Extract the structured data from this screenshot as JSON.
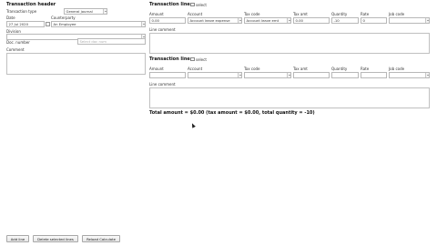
{
  "header": {
    "title": "Transaction header",
    "transaction_type_label": "Transaction type",
    "transaction_type_value": "General journal",
    "date_label": "Date",
    "date_value": "27 Jul 2020",
    "counterparty_label": "Counterparty",
    "counterparty_value": "An Employee",
    "division_label": "Division",
    "doc_number_label": "Doc. number",
    "doc_number_placeholder": "Select doc num",
    "comment_label": "Comment"
  },
  "lines": [
    {
      "title": "Transaction line",
      "select_label": "select",
      "columns": [
        "Amount",
        "Account",
        "Tax code",
        "Tax amt",
        "Quantity",
        "Rate",
        "Job code"
      ],
      "amount": "0.00",
      "account": "Account leave expense",
      "tax_code": "Account leave emt",
      "tax_amt": "0.00",
      "quantity": "-10",
      "rate": "0",
      "job_code": "",
      "line_comment_label": "Line comment"
    },
    {
      "title": "Transaction line",
      "select_label": "select",
      "columns": [
        "Amount",
        "Account",
        "Tax code",
        "Tax amt",
        "Quantity",
        "Rate",
        "Job code"
      ],
      "amount": "",
      "account": "",
      "tax_code": "",
      "tax_amt": "",
      "quantity": "",
      "rate": "",
      "job_code": "",
      "line_comment_label": "Line comment"
    }
  ],
  "total_text": "Total amount = $0.00 (tax amount = $0.00, total quantity = -10)",
  "footer": {
    "add_line": "Add line",
    "delete_selected": "Delete selected lines",
    "reload_calculate": "Reload Calculate"
  }
}
